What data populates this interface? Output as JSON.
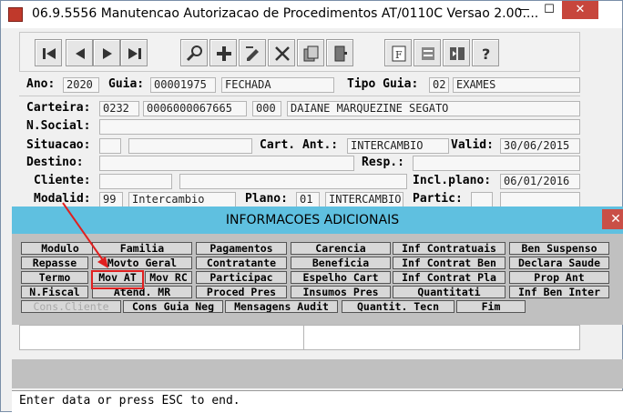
{
  "window": {
    "title": "06.9.5556 Manutencao Autorizacao de Procedimentos AT/0110C Versao 2.00....",
    "minimize": "—",
    "maximize": "☐",
    "close": "✕"
  },
  "toolbar": {
    "buttons": [
      "first-icon",
      "prev-icon",
      "next-icon",
      "last-icon",
      "search-icon",
      "add-icon",
      "edit-icon",
      "delete-icon",
      "copy-icon",
      "exit-door-icon",
      "report-icon",
      "filter-icon",
      "split-icon",
      "help-icon"
    ]
  },
  "header": {
    "ano_label": "Ano:",
    "ano_value": "2020",
    "guia_label": "Guia:",
    "guia_value": "00001975",
    "status_value": "FECHADA",
    "tipo_guia_label": "Tipo Guia:",
    "tipo_guia_code": "02",
    "tipo_guia_value": "EXAMES"
  },
  "form": {
    "carteira_label": "Carteira:",
    "carteira_a": "0232",
    "carteira_b": "0006000067665",
    "carteira_c": "000",
    "carteira_name": "DAIANE MARQUEZINE SEGATO",
    "nsocial_label": "N.Social:",
    "situacao_label": "Situacao:",
    "cart_ant_label": "Cart. Ant.:",
    "cart_ant_value": "INTERCAMBIO",
    "valid_label": "Valid:",
    "valid_value": "30/06/2015",
    "destino_label": "Destino:",
    "resp_label": "Resp.:",
    "cliente_label": "Cliente:",
    "incl_plano_label": "Incl.plano:",
    "incl_plano_value": "06/01/2016",
    "modalid_label": "Modalid:",
    "modalid_code": "99",
    "modalid_value": "Intercambio",
    "plano_label": "Plano:",
    "plano_code": "01",
    "plano_value": "INTERCAMBIO",
    "partic_label": "Partic:"
  },
  "dialog": {
    "title": "INFORMACOES ADICIONAIS",
    "close": "✕",
    "buttons_row1": [
      "Modulo",
      "Familia",
      "Pagamentos",
      "Carencia",
      "Inf Contratuais",
      "Ben Suspenso"
    ],
    "buttons_row2": [
      "Repasse",
      "Movto Geral",
      "Contratante",
      "Beneficia",
      "Inf Contrat Ben",
      "Declara Saude"
    ],
    "buttons_row3": [
      "Termo",
      "Mov AT",
      "Mov RC",
      "Participac",
      "Espelho Cart",
      "Inf Contrat Pla",
      "Prop Ant"
    ],
    "buttons_row4": [
      "N.Fiscal",
      "Atend. MR",
      "Proced Pres",
      "Insumos Pres",
      "Quantitati",
      "Inf Ben Inter"
    ],
    "buttons_row5": [
      "Cons.Cliente",
      "Cons Guia Neg",
      "Mensagens Audit",
      "Quantit. Tecn",
      "Fim"
    ]
  },
  "status": {
    "message": "Enter data or press ESC to end."
  },
  "colors": {
    "dialog_header": "#5fc0e0",
    "highlight": "#e02020"
  }
}
